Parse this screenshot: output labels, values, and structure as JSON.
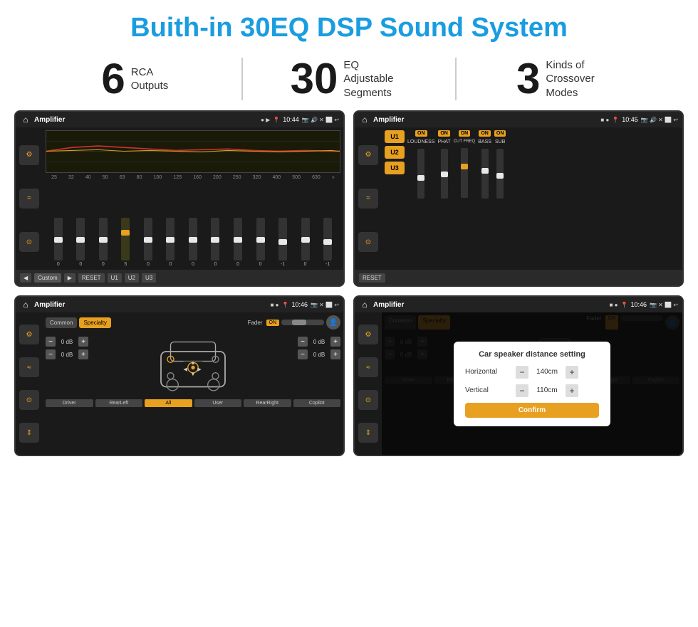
{
  "page": {
    "title": "Buith-in 30EQ DSP Sound System"
  },
  "stats": [
    {
      "number": "6",
      "text": "RCA\nOutputs"
    },
    {
      "number": "30",
      "text": "EQ Adjustable\nSegments"
    },
    {
      "number": "3",
      "text": "Kinds of\nCrossover Modes"
    }
  ],
  "screens": {
    "eq": {
      "title": "Amplifier",
      "time": "10:44",
      "labels": [
        "25",
        "32",
        "40",
        "50",
        "63",
        "80",
        "100",
        "125",
        "160",
        "200",
        "250",
        "320",
        "400",
        "500",
        "630"
      ],
      "values": [
        "0",
        "0",
        "0",
        "5",
        "0",
        "0",
        "0",
        "0",
        "0",
        "0",
        "-1",
        "0",
        "-1"
      ],
      "presets": [
        "Custom",
        "RESET",
        "U1",
        "U2",
        "U3"
      ]
    },
    "amp": {
      "title": "Amplifier",
      "time": "10:45",
      "presets": [
        "U1",
        "U2",
        "U3"
      ],
      "controls": [
        "LOUDNESS",
        "PHAT",
        "CUT FREQ",
        "BASS",
        "SUB"
      ]
    },
    "crossover": {
      "title": "Amplifier",
      "time": "10:46",
      "tabs": [
        "Common",
        "Specialty"
      ],
      "fader_label": "Fader",
      "fader_on": "ON",
      "db_values": [
        "0 dB",
        "0 dB",
        "0 dB",
        "0 dB"
      ],
      "buttons": [
        "Driver",
        "RearLeft",
        "All",
        "User",
        "RearRight",
        "Copilot"
      ]
    },
    "distance": {
      "title": "Amplifier",
      "time": "10:46",
      "tabs": [
        "Common",
        "Specialty"
      ],
      "dialog": {
        "title": "Car speaker distance setting",
        "horizontal_label": "Horizontal",
        "horizontal_value": "140cm",
        "vertical_label": "Vertical",
        "vertical_value": "110cm",
        "confirm_label": "Confirm"
      },
      "db_values": [
        "0 dB",
        "0 dB"
      ],
      "buttons": [
        "Driver",
        "RearLeft",
        "All",
        "User",
        "RearRight",
        "Copilot"
      ]
    }
  }
}
